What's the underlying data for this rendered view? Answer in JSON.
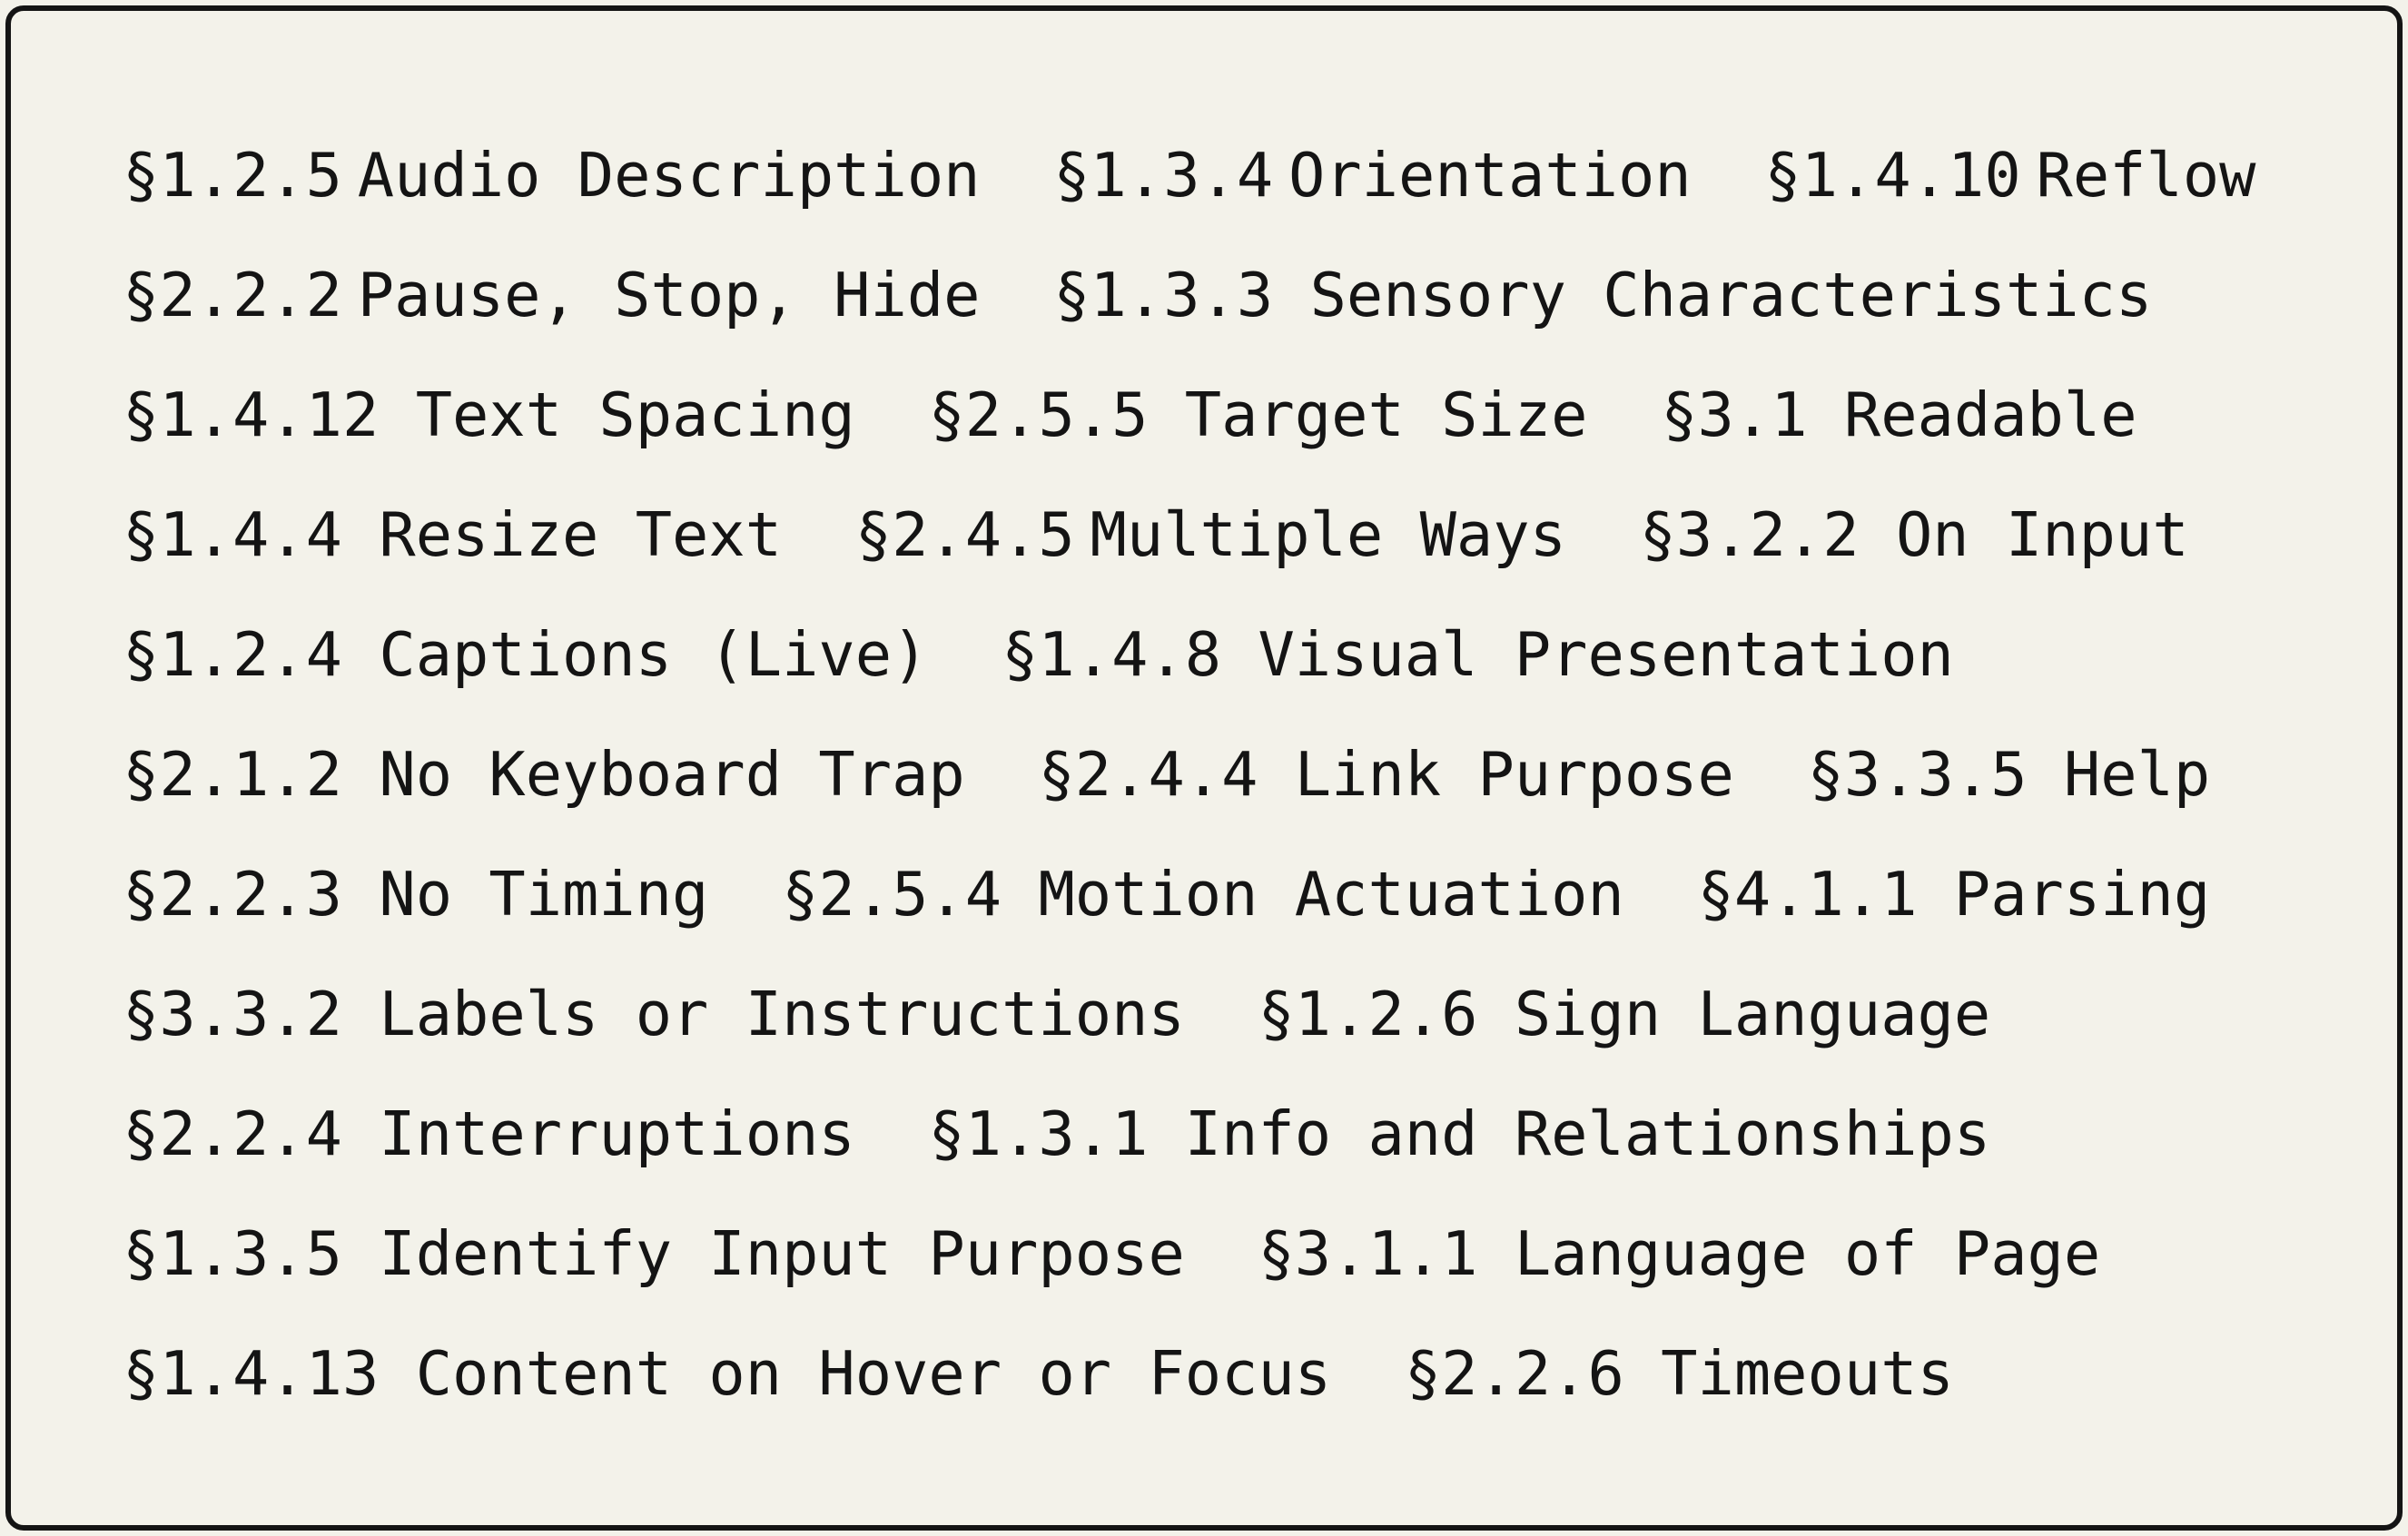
{
  "colors": {
    "background": "#f3f2ea",
    "text": "#141414",
    "border": "#141414"
  },
  "lines": [
    {
      "items": [
        {
          "number": "§1.2.5",
          "title": "Audio Description",
          "join": "tight"
        },
        {
          "number": "§1.3.4",
          "title": "Orientation",
          "join": "tight"
        },
        {
          "number": "§1.4.10",
          "title": "Reflow",
          "join": "tight"
        }
      ]
    },
    {
      "items": [
        {
          "number": "§2.2.2",
          "title": "Pause, Stop, Hide",
          "join": "tight"
        },
        {
          "number": "§1.3.3",
          "title": "Sensory Characteristics",
          "join": "spaced"
        }
      ]
    },
    {
      "items": [
        {
          "number": "§1.4.12",
          "title": "Text Spacing",
          "join": "spaced"
        },
        {
          "number": "§2.5.5",
          "title": "Target Size",
          "join": "spaced"
        },
        {
          "number": "§3.1",
          "title": "Readable",
          "join": "spaced"
        }
      ]
    },
    {
      "items": [
        {
          "number": "§1.4.4",
          "title": "Resize Text",
          "join": "spaced"
        },
        {
          "number": "§2.4.5",
          "title": "Multiple Ways",
          "join": "tight"
        },
        {
          "number": "§3.2.2",
          "title": "On Input",
          "join": "spaced"
        }
      ]
    },
    {
      "items": [
        {
          "number": "§1.2.4",
          "title": "Captions (Live)",
          "join": "spaced"
        },
        {
          "number": "§1.4.8",
          "title": "Visual Presentation",
          "join": "spaced"
        }
      ]
    },
    {
      "items": [
        {
          "number": "§2.1.2",
          "title": "No Keyboard Trap",
          "join": "spaced"
        },
        {
          "number": "§2.4.4",
          "title": "Link Purpose",
          "join": "spaced"
        },
        {
          "number": "§3.3.5",
          "title": "Help",
          "join": "spaced"
        }
      ]
    },
    {
      "items": [
        {
          "number": "§2.2.3",
          "title": "No Timing",
          "join": "spaced"
        },
        {
          "number": "§2.5.4",
          "title": "Motion Actuation",
          "join": "spaced"
        },
        {
          "number": "§4.1.1",
          "title": "Parsing",
          "join": "spaced"
        }
      ]
    },
    {
      "items": [
        {
          "number": "§3.3.2",
          "title": "Labels or Instructions",
          "join": "spaced"
        },
        {
          "number": "§1.2.6",
          "title": "Sign Language",
          "join": "spaced"
        }
      ]
    },
    {
      "items": [
        {
          "number": "§2.2.4",
          "title": "Interruptions",
          "join": "spaced"
        },
        {
          "number": "§1.3.1",
          "title": "Info and Relationships",
          "join": "spaced"
        }
      ]
    },
    {
      "items": [
        {
          "number": "§1.3.5",
          "title": "Identify Input Purpose",
          "join": "spaced"
        },
        {
          "number": "§3.1.1",
          "title": "Language of Page",
          "join": "spaced"
        }
      ]
    },
    {
      "items": [
        {
          "number": "§1.4.13",
          "title": "Content on Hover or Focus",
          "join": "spaced"
        },
        {
          "number": "§2.2.6",
          "title": "Timeouts",
          "join": "spaced"
        }
      ]
    }
  ]
}
